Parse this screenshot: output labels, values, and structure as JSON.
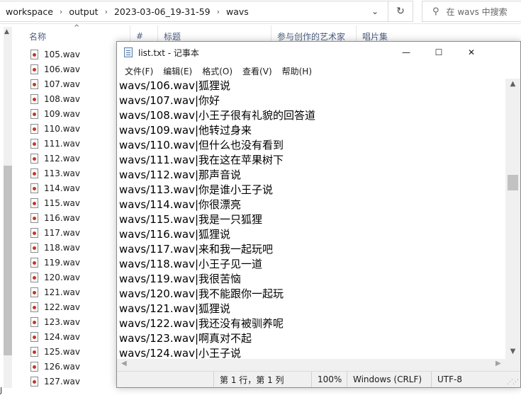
{
  "explorer": {
    "breadcrumb": [
      "workspace",
      "output",
      "2023-03-06_19-31-59",
      "wavs"
    ],
    "breadcrumb_separator": "›",
    "dropdown_glyph": "⌄",
    "refresh_glyph": "↻",
    "search": {
      "placeholder": "在 wavs 中搜索",
      "icon": "search-icon"
    },
    "columns": {
      "name": "名称",
      "number": "#",
      "title": "标题",
      "artists": "参与创作的艺术家",
      "album": "唱片集"
    },
    "files": [
      "105.wav",
      "106.wav",
      "107.wav",
      "108.wav",
      "109.wav",
      "110.wav",
      "111.wav",
      "112.wav",
      "113.wav",
      "114.wav",
      "115.wav",
      "116.wav",
      "117.wav",
      "118.wav",
      "119.wav",
      "120.wav",
      "121.wav",
      "122.wav",
      "123.wav",
      "124.wav",
      "125.wav",
      "126.wav",
      "127.wav"
    ],
    "stray_char": "J"
  },
  "notepad": {
    "title": "list.txt - 记事本",
    "menu": [
      "文件(F)",
      "编辑(E)",
      "格式(O)",
      "查看(V)",
      "帮助(H)"
    ],
    "lines": [
      "wavs/106.wav|狐狸说",
      "wavs/107.wav|你好",
      "wavs/108.wav|小王子很有礼貌的回答道",
      "wavs/109.wav|他转过身来",
      "wavs/110.wav|但什么也没有看到",
      "wavs/111.wav|我在这在苹果树下",
      "wavs/112.wav|那声音说",
      "wavs/113.wav|你是谁小王子说",
      "wavs/114.wav|你很漂亮",
      "wavs/115.wav|我是一只狐狸",
      "wavs/116.wav|狐狸说",
      "wavs/117.wav|来和我一起玩吧",
      "wavs/118.wav|小王子见一道",
      "wavs/119.wav|我很苦恼",
      "wavs/120.wav|我不能跟你一起玩",
      "wavs/121.wav|狐狸说",
      "wavs/122.wav|我还没有被驯养呢",
      "wavs/123.wav|啊真对不起",
      "wavs/124.wav|小王子说"
    ],
    "status": {
      "position": "第 1 行，第 1 列",
      "zoom": "100%",
      "line_ending": "Windows (CRLF)",
      "encoding": "UTF-8"
    },
    "window_buttons": {
      "minimize": "—",
      "maximize": "☐",
      "close": "✕"
    },
    "scroll_glyphs": {
      "up": "▲",
      "down": "▼",
      "left": "◀",
      "right": "▶"
    }
  }
}
